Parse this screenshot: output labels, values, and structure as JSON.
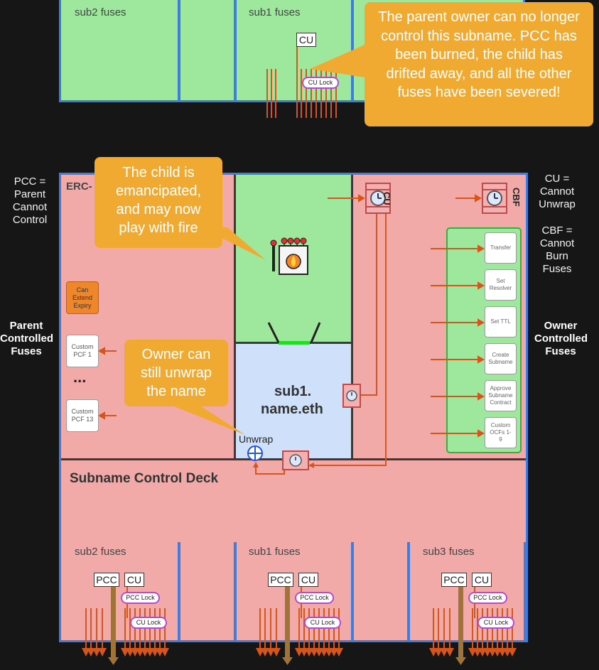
{
  "top_panel": {
    "sub2_label": "sub2 fuses",
    "sub1_label": "sub1 fuses",
    "cu_tag": "CU",
    "cu_lock": "CU Lock"
  },
  "callouts": {
    "parent_owner": "The parent owner can no longer control this subname. PCC has been burned, the child has drifted away, and all the other fuses have been severed!",
    "emancipated": "The child is emancipated, and may now play with fire",
    "owner_unwrap": "Owner can still unwrap the name"
  },
  "legend": {
    "pcc": "PCC = Parent Cannot Control",
    "cu": "CU = Cannot Unwrap",
    "cbf": "CBF = Cannot Burn Fuses"
  },
  "sides": {
    "parent_controlled": "Parent Controlled Fuses",
    "owner_controlled": "Owner Controlled Fuses"
  },
  "left_column": {
    "erc_label": "ERC-",
    "can_extend": "Can Extend Expiry",
    "custom_pcf_1": "Custom PCF 1",
    "ellipsis": "...",
    "custom_pcf_13": "Custom PCF 13"
  },
  "center": {
    "name_line1": "sub1.",
    "name_line2": "name.eth",
    "unwrap_label": "Unwrap"
  },
  "right_column": {
    "cu_rot": "CU",
    "cbf_rot": "CBF",
    "ocfs": [
      "Transfer",
      "Set Resolver",
      "Set TTL",
      "Create Subname",
      "Approve Subname Contract",
      "Custom OCFs 1-9"
    ]
  },
  "deck": {
    "title": "Subname Control Deck",
    "sub2_label": "sub2 fuses",
    "sub1_label": "sub1 fuses",
    "sub3_label": "sub3 fuses",
    "pcc_tag": "PCC",
    "cu_tag": "CU",
    "pcc_lock": "PCC Lock",
    "cu_lock": "CU Lock"
  },
  "colors": {
    "green": "#9ee89e",
    "pink": "#f2aaa8",
    "blue_room": "#cfe0fb",
    "callout": "#f0aa32",
    "fuse_orange": "#d5551c",
    "border_blue": "#3b7de0",
    "lock_purple": "#b44ad8"
  }
}
